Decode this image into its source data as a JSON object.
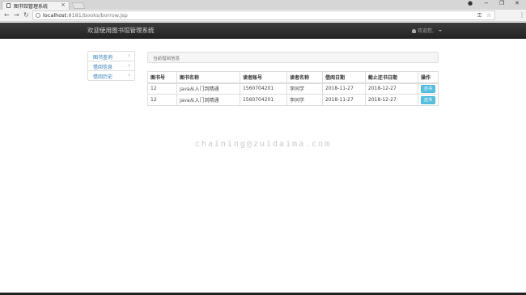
{
  "browser": {
    "tab_title": "图书馆管理系统",
    "tab_close": "×",
    "url_host": "localhost",
    "url_rest": ":8181/books/borrow.jsp",
    "icons": [
      "back-icon",
      "forward-icon",
      "reload-icon",
      "key-icon",
      "zoom-icon",
      "star-icon",
      "menu-icon"
    ]
  },
  "navbar": {
    "brand": "欢迎使用图书馆管理系统",
    "user_label": "欢迎您,"
  },
  "sidebar": {
    "items": [
      {
        "label": "图书查询"
      },
      {
        "label": "借阅信息"
      },
      {
        "label": "借阅历史"
      }
    ]
  },
  "panel": {
    "heading": "当前借阅信息"
  },
  "table": {
    "headers": [
      "图书号",
      "图书名称",
      "读者账号",
      "读者名称",
      "借阅日期",
      "截止还书日期",
      "操作"
    ],
    "rows": [
      [
        "12",
        "java从入门到精通",
        "1560704201",
        "李同学",
        "2018-11-27",
        "2018-12-27",
        "还书"
      ],
      [
        "12",
        "java从入门到精通",
        "1560704201",
        "李同学",
        "2018-11-27",
        "2018-12-27",
        "还书"
      ]
    ]
  },
  "watermark": "chaining@zuidaima.com"
}
